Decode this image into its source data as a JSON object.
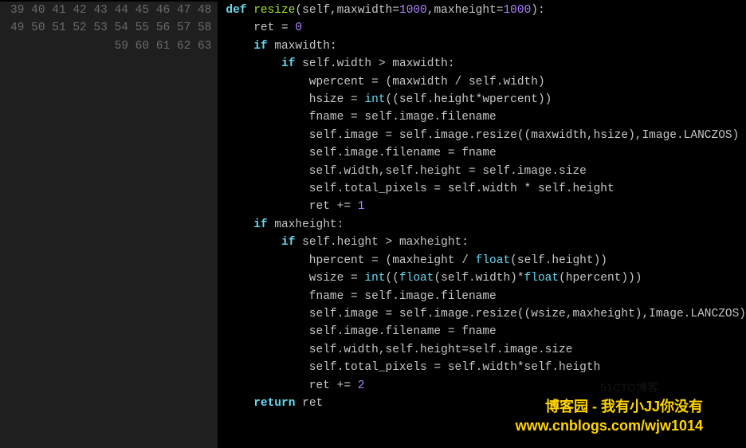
{
  "first_line_number": 39,
  "lines": [
    [
      [
        "kw",
        "def "
      ],
      [
        "fn",
        "resize"
      ],
      [
        "op",
        "(self,maxwidth="
      ],
      [
        "num",
        "1000"
      ],
      [
        "op",
        ",maxheight="
      ],
      [
        "num",
        "1000"
      ],
      [
        "op",
        "):"
      ]
    ],
    [
      [
        "op",
        "    ret = "
      ],
      [
        "num",
        "0"
      ]
    ],
    [
      [
        "op",
        "    "
      ],
      [
        "kw",
        "if"
      ],
      [
        "op",
        " maxwidth:"
      ]
    ],
    [
      [
        "op",
        "        "
      ],
      [
        "kw",
        "if"
      ],
      [
        "op",
        " self.width > maxwidth:"
      ]
    ],
    [
      [
        "op",
        "            wpercent = (maxwidth / self.width)"
      ]
    ],
    [
      [
        "op",
        "            hsize = "
      ],
      [
        "bi",
        "int"
      ],
      [
        "op",
        "((self.height*wpercent))"
      ]
    ],
    [
      [
        "op",
        "            fname = self.image.filename"
      ]
    ],
    [
      [
        "op",
        "            self.image = self.image.resize((maxwidth,hsize),Image.LANCZOS)"
      ]
    ],
    [
      [
        "op",
        "            self.image.filename = fname"
      ]
    ],
    [
      [
        "op",
        "            self.width,self.height = self.image.size"
      ]
    ],
    [
      [
        "op",
        "            self.total_pixels = self.width * self.height"
      ]
    ],
    [
      [
        "op",
        "            ret += "
      ],
      [
        "num",
        "1"
      ]
    ],
    [
      [
        "op",
        "    "
      ],
      [
        "kw",
        "if"
      ],
      [
        "op",
        " maxheight:"
      ]
    ],
    [
      [
        "op",
        "        "
      ],
      [
        "kw",
        "if"
      ],
      [
        "op",
        " self.height > maxheight:"
      ]
    ],
    [
      [
        "op",
        "            hpercent = (maxheight / "
      ],
      [
        "bi",
        "float"
      ],
      [
        "op",
        "(self.height))"
      ]
    ],
    [
      [
        "op",
        "            wsize = "
      ],
      [
        "bi",
        "int"
      ],
      [
        "op",
        "(("
      ],
      [
        "bi",
        "float"
      ],
      [
        "op",
        "(self.width)*"
      ],
      [
        "bi",
        "float"
      ],
      [
        "op",
        "(hpercent)))"
      ]
    ],
    [
      [
        "op",
        "            fname = self.image.filename"
      ]
    ],
    [
      [
        "op",
        "            self.image = self.image.resize((wsize,maxheight),Image.LANCZOS)"
      ]
    ],
    [
      [
        "op",
        "            self.image.filename = fname"
      ]
    ],
    [
      [
        "op",
        "            self.width,self.height=self.image.size"
      ]
    ],
    [
      [
        "op",
        "            self.total_pixels = self.width*self.heigth"
      ]
    ],
    [
      [
        "op",
        "            ret += "
      ],
      [
        "num",
        "2"
      ]
    ],
    [
      [
        "op",
        "    "
      ],
      [
        "kw",
        "return"
      ],
      [
        "op",
        " ret"
      ]
    ],
    [],
    []
  ],
  "watermark_cn": "博客园 - 我有小JJ你没有",
  "watermark_url": "www.cnblogs.com/wjw1014",
  "faint_mark": "51CTO博客"
}
